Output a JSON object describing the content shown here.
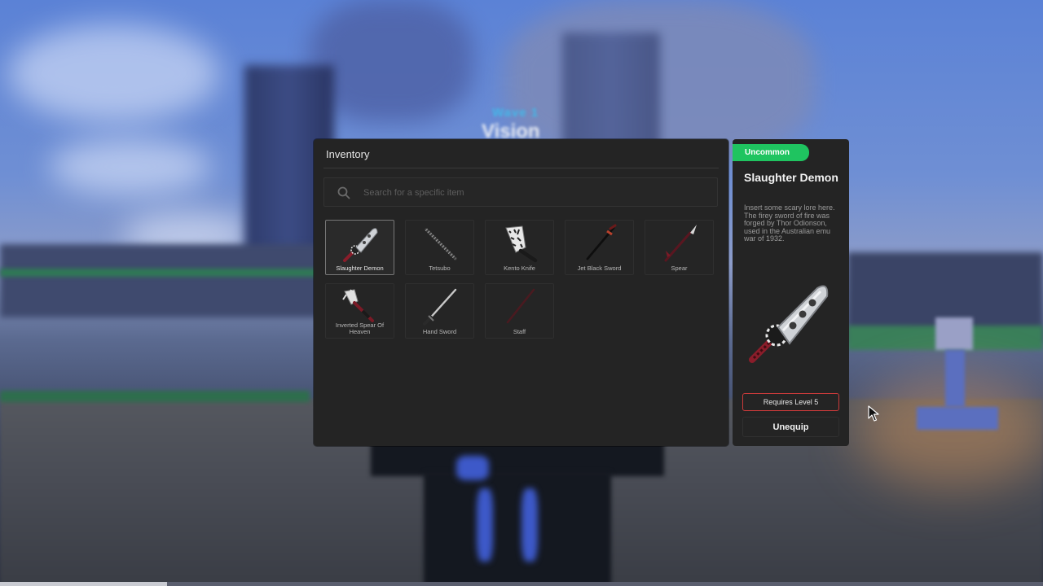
{
  "hud": {
    "wave": "Wave 1",
    "title": "Vision"
  },
  "inventory": {
    "title": "Inventory",
    "search_placeholder": "Search for a specific item",
    "items": [
      {
        "name": "Slaughter Demon",
        "icon": "cleaver-sword-icon",
        "selected": true
      },
      {
        "name": "Tetsubo",
        "icon": "tetsubo-icon"
      },
      {
        "name": "Kento Knife",
        "icon": "knife-icon"
      },
      {
        "name": "Jet Black Sword",
        "icon": "katana-icon"
      },
      {
        "name": "Spear",
        "icon": "spear-icon"
      },
      {
        "name": "Inverted Spear Of Heaven",
        "icon": "inverted-spear-icon"
      },
      {
        "name": "Hand Sword",
        "icon": "hand-sword-icon"
      },
      {
        "name": "Staff",
        "icon": "staff-icon"
      }
    ]
  },
  "detail": {
    "rarity": "Uncommon",
    "rarity_color": "#1fc460",
    "name": "Slaughter Demon",
    "description": "Insert some scary lore here. The firey sword of fire was forged by Thor Odionson, used in the Australian emu war of 1932.",
    "requirement": "Requires Level 5",
    "requirement_color": "#c93a3a",
    "action": "Unequip"
  },
  "progress": {
    "fraction": 0.16
  }
}
